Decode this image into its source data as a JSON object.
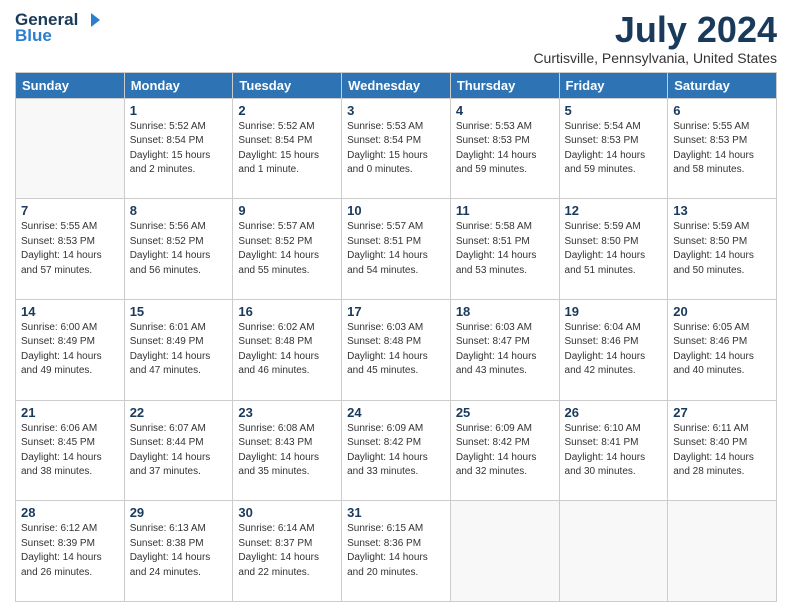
{
  "header": {
    "logo_general": "General",
    "logo_blue": "Blue",
    "month_title": "July 2024",
    "location": "Curtisville, Pennsylvania, United States"
  },
  "days_of_week": [
    "Sunday",
    "Monday",
    "Tuesday",
    "Wednesday",
    "Thursday",
    "Friday",
    "Saturday"
  ],
  "weeks": [
    [
      {
        "day": "",
        "info": ""
      },
      {
        "day": "1",
        "info": "Sunrise: 5:52 AM\nSunset: 8:54 PM\nDaylight: 15 hours\nand 2 minutes."
      },
      {
        "day": "2",
        "info": "Sunrise: 5:52 AM\nSunset: 8:54 PM\nDaylight: 15 hours\nand 1 minute."
      },
      {
        "day": "3",
        "info": "Sunrise: 5:53 AM\nSunset: 8:54 PM\nDaylight: 15 hours\nand 0 minutes."
      },
      {
        "day": "4",
        "info": "Sunrise: 5:53 AM\nSunset: 8:53 PM\nDaylight: 14 hours\nand 59 minutes."
      },
      {
        "day": "5",
        "info": "Sunrise: 5:54 AM\nSunset: 8:53 PM\nDaylight: 14 hours\nand 59 minutes."
      },
      {
        "day": "6",
        "info": "Sunrise: 5:55 AM\nSunset: 8:53 PM\nDaylight: 14 hours\nand 58 minutes."
      }
    ],
    [
      {
        "day": "7",
        "info": "Sunrise: 5:55 AM\nSunset: 8:53 PM\nDaylight: 14 hours\nand 57 minutes."
      },
      {
        "day": "8",
        "info": "Sunrise: 5:56 AM\nSunset: 8:52 PM\nDaylight: 14 hours\nand 56 minutes."
      },
      {
        "day": "9",
        "info": "Sunrise: 5:57 AM\nSunset: 8:52 PM\nDaylight: 14 hours\nand 55 minutes."
      },
      {
        "day": "10",
        "info": "Sunrise: 5:57 AM\nSunset: 8:51 PM\nDaylight: 14 hours\nand 54 minutes."
      },
      {
        "day": "11",
        "info": "Sunrise: 5:58 AM\nSunset: 8:51 PM\nDaylight: 14 hours\nand 53 minutes."
      },
      {
        "day": "12",
        "info": "Sunrise: 5:59 AM\nSunset: 8:50 PM\nDaylight: 14 hours\nand 51 minutes."
      },
      {
        "day": "13",
        "info": "Sunrise: 5:59 AM\nSunset: 8:50 PM\nDaylight: 14 hours\nand 50 minutes."
      }
    ],
    [
      {
        "day": "14",
        "info": "Sunrise: 6:00 AM\nSunset: 8:49 PM\nDaylight: 14 hours\nand 49 minutes."
      },
      {
        "day": "15",
        "info": "Sunrise: 6:01 AM\nSunset: 8:49 PM\nDaylight: 14 hours\nand 47 minutes."
      },
      {
        "day": "16",
        "info": "Sunrise: 6:02 AM\nSunset: 8:48 PM\nDaylight: 14 hours\nand 46 minutes."
      },
      {
        "day": "17",
        "info": "Sunrise: 6:03 AM\nSunset: 8:48 PM\nDaylight: 14 hours\nand 45 minutes."
      },
      {
        "day": "18",
        "info": "Sunrise: 6:03 AM\nSunset: 8:47 PM\nDaylight: 14 hours\nand 43 minutes."
      },
      {
        "day": "19",
        "info": "Sunrise: 6:04 AM\nSunset: 8:46 PM\nDaylight: 14 hours\nand 42 minutes."
      },
      {
        "day": "20",
        "info": "Sunrise: 6:05 AM\nSunset: 8:46 PM\nDaylight: 14 hours\nand 40 minutes."
      }
    ],
    [
      {
        "day": "21",
        "info": "Sunrise: 6:06 AM\nSunset: 8:45 PM\nDaylight: 14 hours\nand 38 minutes."
      },
      {
        "day": "22",
        "info": "Sunrise: 6:07 AM\nSunset: 8:44 PM\nDaylight: 14 hours\nand 37 minutes."
      },
      {
        "day": "23",
        "info": "Sunrise: 6:08 AM\nSunset: 8:43 PM\nDaylight: 14 hours\nand 35 minutes."
      },
      {
        "day": "24",
        "info": "Sunrise: 6:09 AM\nSunset: 8:42 PM\nDaylight: 14 hours\nand 33 minutes."
      },
      {
        "day": "25",
        "info": "Sunrise: 6:09 AM\nSunset: 8:42 PM\nDaylight: 14 hours\nand 32 minutes."
      },
      {
        "day": "26",
        "info": "Sunrise: 6:10 AM\nSunset: 8:41 PM\nDaylight: 14 hours\nand 30 minutes."
      },
      {
        "day": "27",
        "info": "Sunrise: 6:11 AM\nSunset: 8:40 PM\nDaylight: 14 hours\nand 28 minutes."
      }
    ],
    [
      {
        "day": "28",
        "info": "Sunrise: 6:12 AM\nSunset: 8:39 PM\nDaylight: 14 hours\nand 26 minutes."
      },
      {
        "day": "29",
        "info": "Sunrise: 6:13 AM\nSunset: 8:38 PM\nDaylight: 14 hours\nand 24 minutes."
      },
      {
        "day": "30",
        "info": "Sunrise: 6:14 AM\nSunset: 8:37 PM\nDaylight: 14 hours\nand 22 minutes."
      },
      {
        "day": "31",
        "info": "Sunrise: 6:15 AM\nSunset: 8:36 PM\nDaylight: 14 hours\nand 20 minutes."
      },
      {
        "day": "",
        "info": ""
      },
      {
        "day": "",
        "info": ""
      },
      {
        "day": "",
        "info": ""
      }
    ]
  ]
}
